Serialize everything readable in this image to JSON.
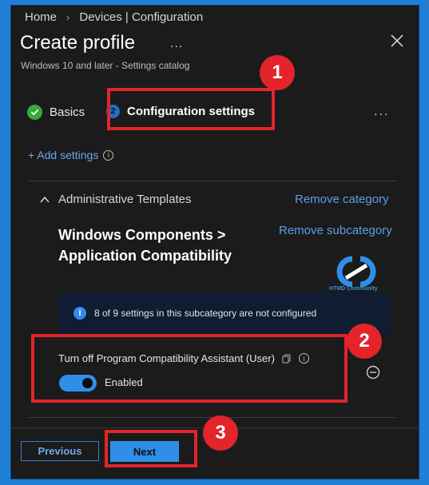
{
  "breadcrumb": [
    "Home",
    "Devices | Configuration"
  ],
  "header": {
    "title": "Create profile",
    "more": "...",
    "subtitle": "Windows 10 and later - Settings catalog"
  },
  "steps": [
    {
      "label": "Basics",
      "state": "complete"
    },
    {
      "label": "Configuration settings",
      "number": "2",
      "state": "current"
    }
  ],
  "tabs_more": "...",
  "add_settings": "+ Add settings",
  "category": {
    "name": "Administrative Templates",
    "remove_label": "Remove category"
  },
  "subcategory": {
    "title": "Windows Components > Application Compatibility",
    "remove_label": "Remove subcategory"
  },
  "watermark": {
    "text": "HTMD Community"
  },
  "info_bar": {
    "text": "8 of 9 settings in this subcategory are not configured"
  },
  "setting": {
    "label": "Turn off Program Compatibility Assistant (User)",
    "toggle_value": "Enabled",
    "enabled": true
  },
  "footer": {
    "previous_label": "Previous",
    "next_label": "Next"
  },
  "callouts": [
    "1",
    "2",
    "3"
  ],
  "colors": {
    "background": "#1b1b1b",
    "accent": "#2f8fe8",
    "link": "#5b9fe8",
    "callout": "#e3242b",
    "success": "#3aa83a"
  }
}
